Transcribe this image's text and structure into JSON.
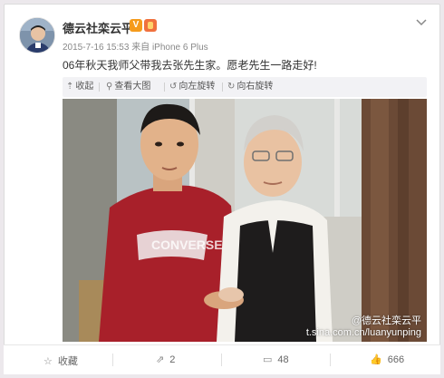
{
  "user": {
    "name": "德云社栾云平",
    "verified_badge": "V",
    "avatar_icon": "avatar"
  },
  "meta": {
    "date": "2015-7-16 15:53",
    "source": "来自 iPhone 6 Plus"
  },
  "post": {
    "text": "06年秋天我师父带我去张先生家。愿老先生一路走好!"
  },
  "toolbar": {
    "collapse": "收起",
    "view_large": "查看大图",
    "rotate_left": "向左旋转",
    "rotate_right": "向右旋转"
  },
  "photo": {
    "watermark_name": "@德云社栾云平",
    "watermark_url": "t.sina.com.cn/luanyunping"
  },
  "footer": {
    "favorite": "收藏",
    "repost_count": "2",
    "comment_count": "48",
    "like_count": "666"
  },
  "colors": {
    "accent": "#f59b1c",
    "background": "#ece8ec"
  }
}
